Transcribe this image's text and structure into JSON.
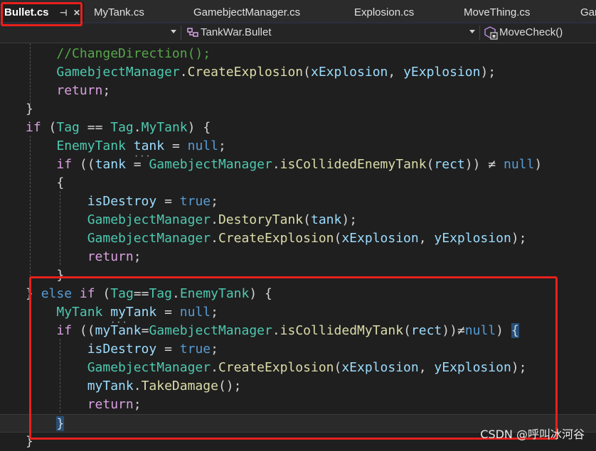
{
  "tabs": [
    {
      "label": "Bullet.cs",
      "active": true
    },
    {
      "label": "MyTank.cs"
    },
    {
      "label": "GamebjectManager.cs"
    },
    {
      "label": "Explosion.cs"
    },
    {
      "label": "MoveThing.cs"
    },
    {
      "label": "Gan"
    }
  ],
  "tab_icons": {
    "pin": "pin-icon",
    "close": "close-icon"
  },
  "nav": {
    "type_dropdown": "TankWar.Bullet",
    "member_dropdown": "MoveCheck()",
    "type_icon": "class-icon",
    "member_icon": "method-icon"
  },
  "code_lines": [
    [
      "    ",
      "//ChangeDirection();"
    ],
    [
      "    ",
      "GamebjectManager",
      ".",
      "CreateExplosion",
      "(",
      "xExplosion",
      ", ",
      "yExplosion",
      ");"
    ],
    [
      "    ",
      "return",
      ";"
    ],
    [
      "}"
    ],
    [
      "if",
      " (",
      "Tag",
      " == ",
      "Tag",
      ".",
      "MyTank",
      ") {"
    ],
    [
      "    ",
      "EnemyTank",
      " ",
      "tank",
      " = ",
      "null",
      ";"
    ],
    [
      "    ",
      "if",
      " ((",
      "tank",
      " = ",
      "GamebjectManager",
      ".",
      "isCollidedEnemyTank",
      "(",
      "rect",
      ")) ",
      "≠",
      " ",
      "null",
      ")"
    ],
    [
      "    ",
      "{"
    ],
    [
      "        ",
      "isDestroy",
      " = ",
      "true",
      ";"
    ],
    [
      "        ",
      "GamebjectManager",
      ".",
      "DestoryTank",
      "(",
      "tank",
      ");"
    ],
    [
      "        ",
      "GamebjectManager",
      ".",
      "CreateExplosion",
      "(",
      "xExplosion",
      ", ",
      "yExplosion",
      ");"
    ],
    [
      "        ",
      "return",
      ";"
    ],
    [
      "    ",
      "}"
    ],
    [
      "} ",
      "else",
      " ",
      "if",
      " (",
      "Tag",
      "==",
      "Tag",
      ".",
      "EnemyTank",
      ") {"
    ],
    [
      "    ",
      "MyTank",
      " ",
      "myTank",
      " = ",
      "null",
      ";"
    ],
    [
      "    ",
      "if",
      " ((",
      "myTank",
      "=",
      "GamebjectManager",
      ".",
      "isCollidedMyTank",
      "(",
      "rect",
      "))",
      "≠",
      "null",
      ") ",
      "{"
    ],
    [
      "        ",
      "isDestroy",
      " = ",
      "true",
      ";"
    ],
    [
      "        ",
      "GamebjectManager",
      ".",
      "CreateExplosion",
      "(",
      "xExplosion",
      ", ",
      "yExplosion",
      ");"
    ],
    [
      "        ",
      "myTank",
      ".",
      "TakeDamage",
      "();"
    ],
    [
      "        ",
      "return",
      ";"
    ],
    [
      "    ",
      "}"
    ],
    [
      "}"
    ]
  ],
  "syntax_colors": {
    "keyword": "#569cd6",
    "control": "#d8a0df",
    "type": "#4ec9b0",
    "method": "#dcdcaa",
    "identifier": "#9cdcfe",
    "comment": "#57a64a",
    "plain": "#d4d4d4"
  },
  "annotation_color": "#e8201c",
  "watermark": "CSDN @呼叫冰河谷"
}
